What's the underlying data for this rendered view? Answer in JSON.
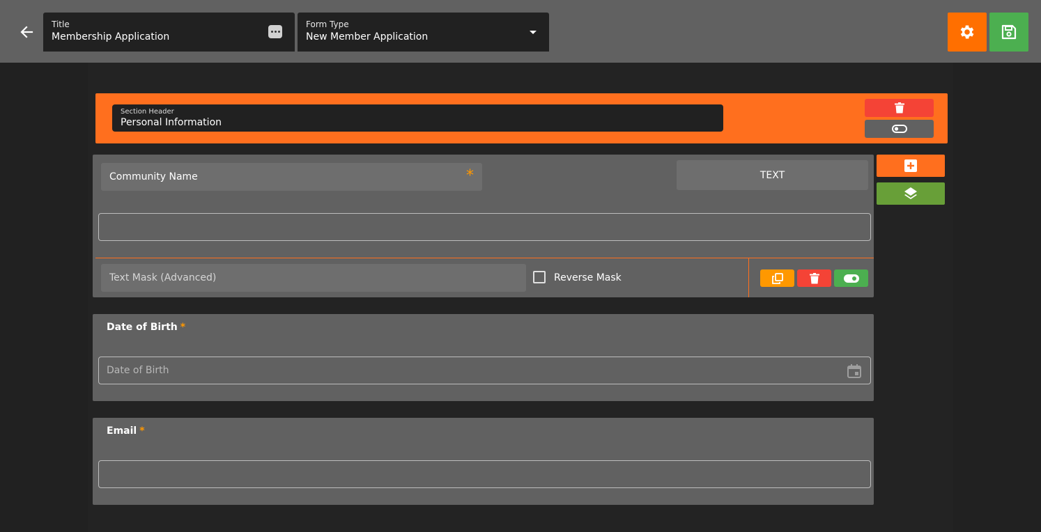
{
  "header": {
    "title_field": {
      "label": "Title",
      "value": "Membership Application"
    },
    "form_type_field": {
      "label": "Form Type",
      "value": "New Member Application"
    }
  },
  "section": {
    "header_label": "Section Header",
    "header_value": "Personal Information"
  },
  "fields": [
    {
      "name": "Community Name",
      "required": "*",
      "type": "TEXT",
      "text_mask_placeholder": "Text Mask (Advanced)",
      "reverse_mask_label": "Reverse Mask"
    },
    {
      "name": "Date of Birth",
      "required": "*",
      "placeholder": "Date of Birth"
    },
    {
      "name": "Email",
      "required": "*"
    }
  ],
  "icons": {
    "back": "arrow-left-icon",
    "more": "more-dots-icon",
    "dropdown": "caret-down-icon",
    "settings": "gear-icon",
    "save": "floppy-disk-icon",
    "delete": "trash-icon",
    "toggle": "toggle-icon",
    "add": "plus-square-icon",
    "layers": "layers-icon",
    "copy": "copy-icon",
    "calendar": "calendar-icon"
  },
  "colors": {
    "accent_orange": "#ff6f1e",
    "settings_orange": "#ff6f00",
    "save_green": "#4caf50",
    "delete_red": "#f44336",
    "copy_amber": "#ff9800",
    "layers_green": "#689f38",
    "background": "#212121",
    "card": "#616161"
  }
}
